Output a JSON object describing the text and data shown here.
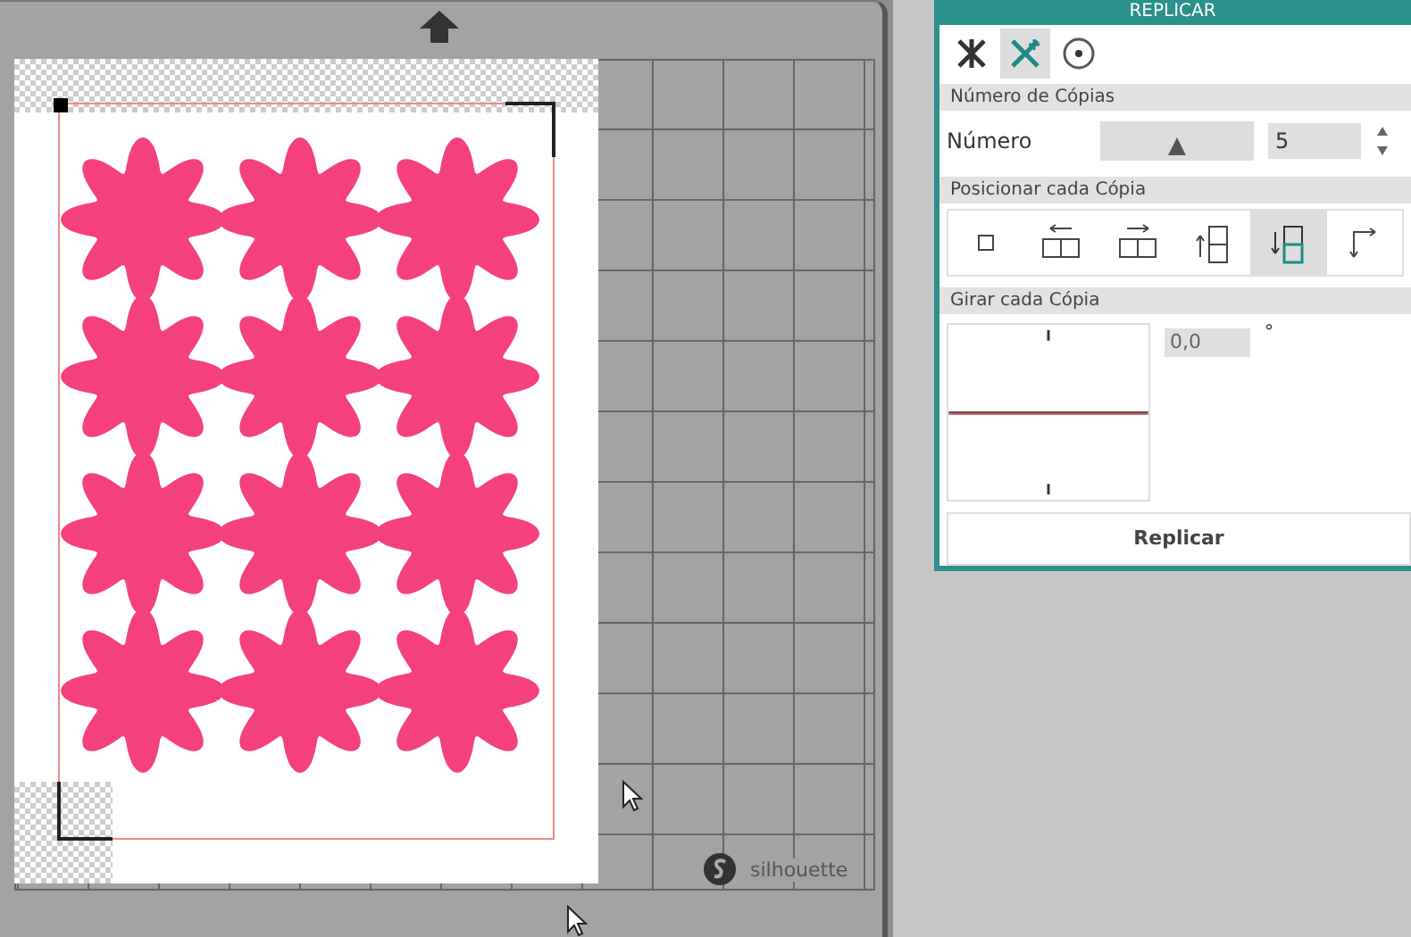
{
  "mat": {
    "logo": "silhouette"
  },
  "panel": {
    "title": "REPLICAR",
    "tabs": [
      {
        "kind": "mirror",
        "selected": false
      },
      {
        "kind": "replicate",
        "selected": true
      },
      {
        "kind": "rotate",
        "selected": false
      }
    ],
    "copies": {
      "heading": "Número de Cópias",
      "label": "Número",
      "level": 0.5,
      "value": "5"
    },
    "position": {
      "heading": "Posicionar cada Cópia",
      "options": [
        {
          "kind": "single",
          "selected": false
        },
        {
          "kind": "left",
          "selected": false
        },
        {
          "kind": "right",
          "selected": false
        },
        {
          "kind": "up",
          "selected": false
        },
        {
          "kind": "down",
          "selected": true
        },
        {
          "kind": "corner",
          "selected": false
        }
      ]
    },
    "rotate": {
      "heading": "Girar cada Cópia",
      "value": "0,0",
      "unit": "°"
    },
    "button": "Replicar"
  }
}
